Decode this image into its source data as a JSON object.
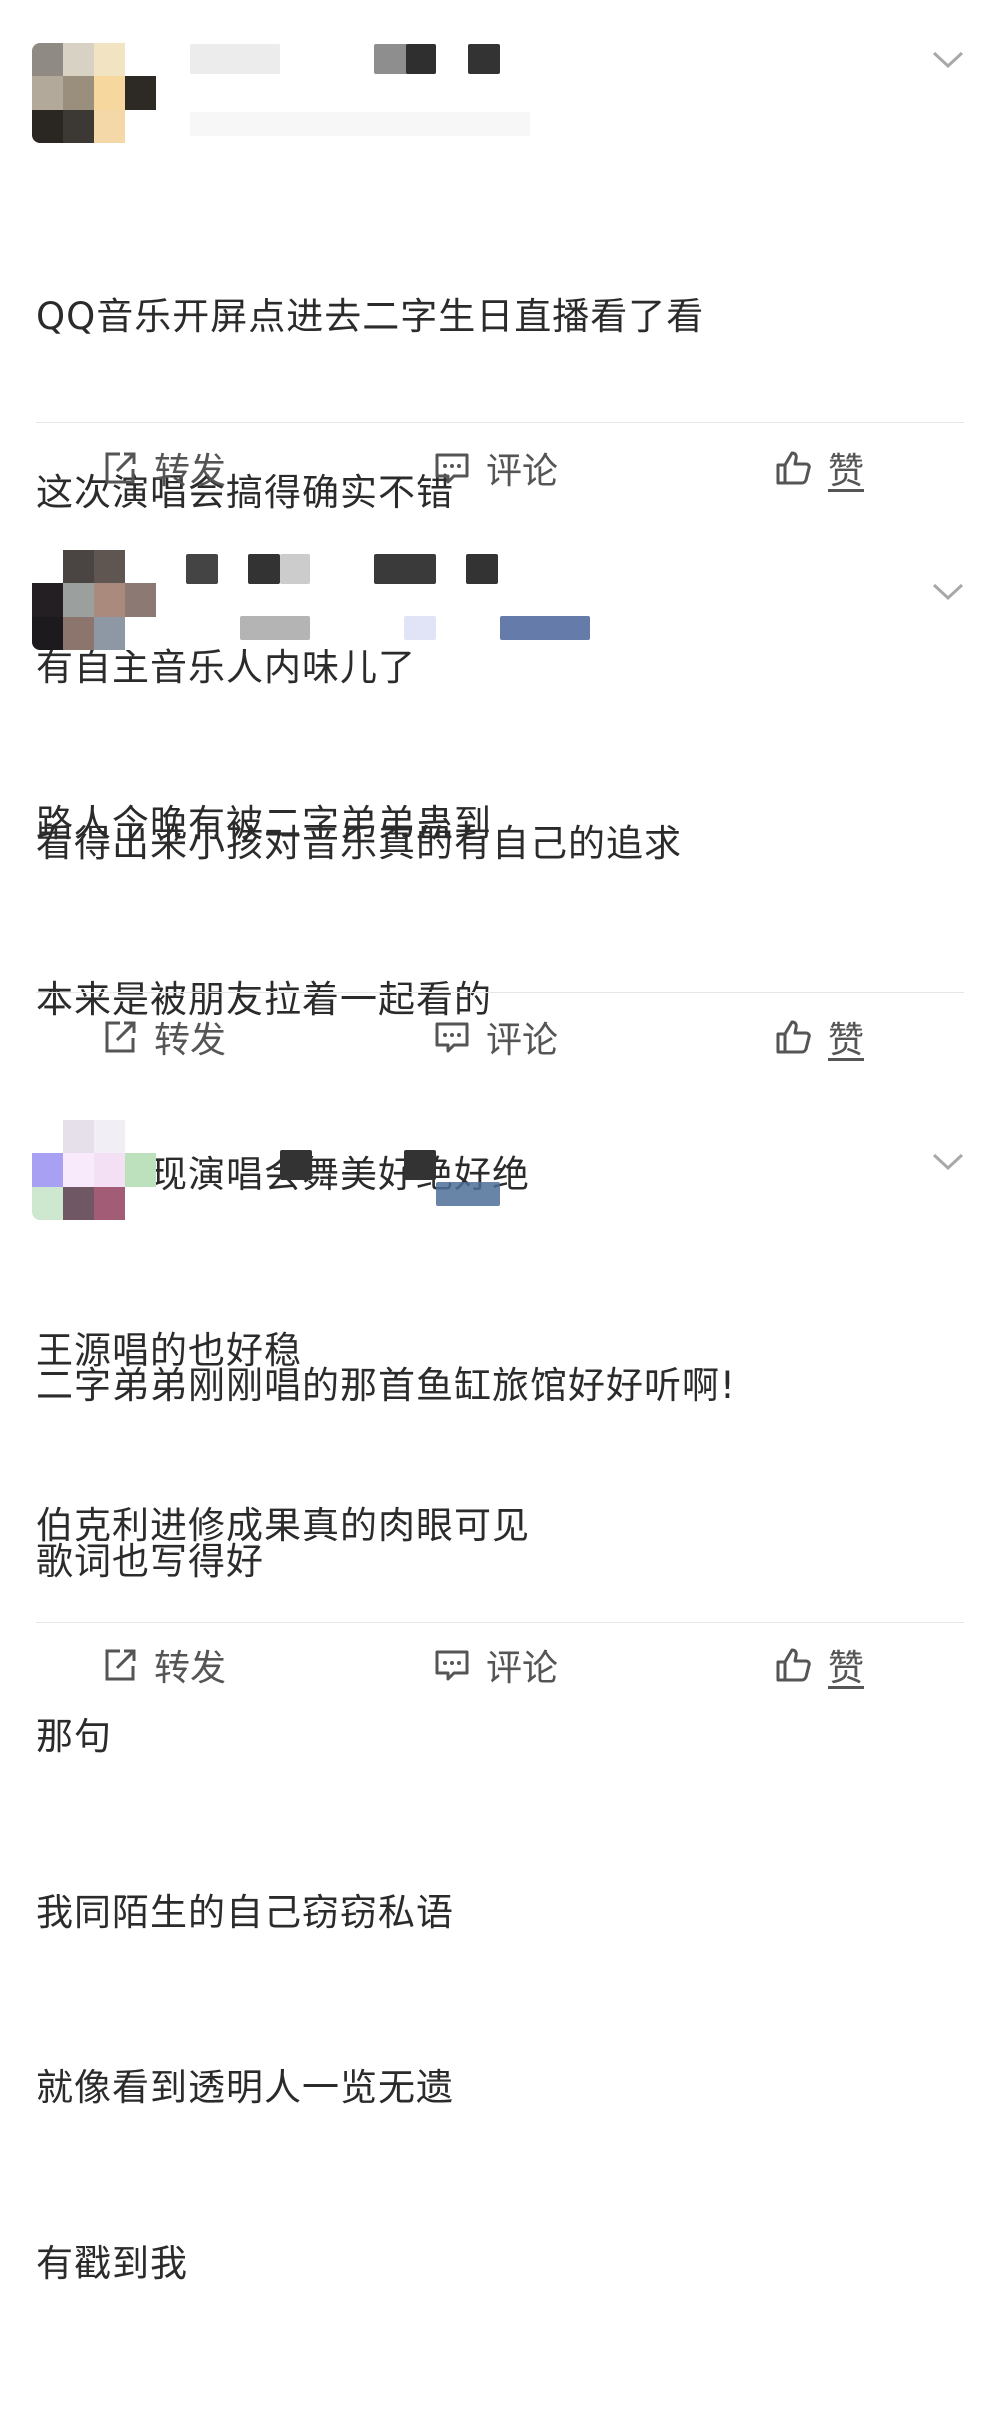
{
  "posts": [
    {
      "lines": [
        "QQ音乐开屏点进去二字生日直播看了看",
        "这次演唱会搞得确实不错",
        "有自主音乐人内味儿了",
        "看得出来小孩对音乐真的有自己的追求"
      ],
      "actions": {
        "repost": "转发",
        "comment": "评论",
        "like": "赞"
      }
    },
    {
      "lines": [
        "路人今晚有被二字弟弟蛊到",
        "本来是被朋友拉着一起看的",
        "结果发现演唱会舞美好绝好绝",
        "王源唱的也好稳",
        "伯克利进修成果真的肉眼可见"
      ],
      "actions": {
        "repost": "转发",
        "comment": "评论",
        "like": "赞"
      }
    },
    {
      "lines": [
        "二字弟弟刚刚唱的那首鱼缸旅馆好好听啊!",
        "歌词也写得好",
        "那句",
        "我同陌生的自己窃窃私语",
        "就像看到透明人一览无遗",
        "有戳到我"
      ],
      "actions": {
        "repost": "转发",
        "comment": "评论",
        "like": "赞"
      }
    }
  ],
  "icons": {
    "repost": "share-box-icon",
    "comment": "comment-bubble-icon",
    "like": "thumbs-up-icon",
    "more": "chevron-down-icon"
  },
  "colors": {
    "text": "#2b2b2b",
    "action_text": "#555555",
    "divider": "#e6e6e6"
  }
}
